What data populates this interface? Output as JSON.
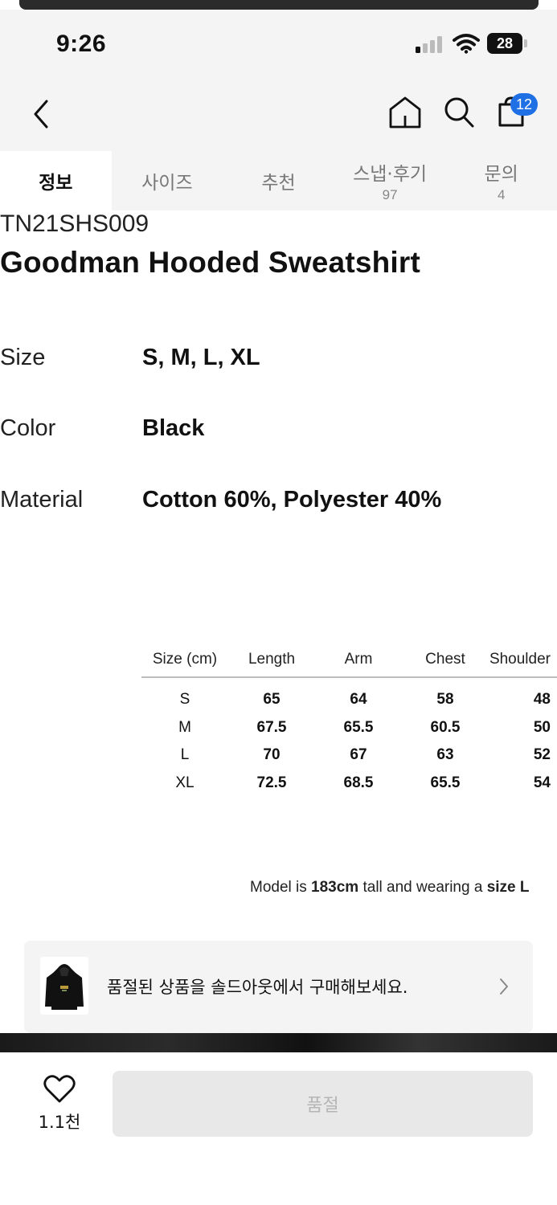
{
  "status_bar": {
    "time": "9:26",
    "battery": "28"
  },
  "header": {
    "cart_count": "12"
  },
  "tabs": [
    {
      "label": "정보",
      "count": ""
    },
    {
      "label": "사이즈",
      "count": ""
    },
    {
      "label": "추천",
      "count": ""
    },
    {
      "label": "스냅·후기",
      "count": "97"
    },
    {
      "label": "문의",
      "count": "4"
    }
  ],
  "product": {
    "code": "TN21SHS009",
    "name": "Goodman Hooded Sweatshirt",
    "specs": [
      {
        "label": "Size",
        "value": "S, M, L, XL"
      },
      {
        "label": "Color",
        "value": "Black"
      },
      {
        "label": "Material",
        "value": "Cotton 60%, Polyester 40%"
      }
    ]
  },
  "size_table": {
    "headers": [
      "Size (cm)",
      "Length",
      "Arm",
      "Chest",
      "Shoulder"
    ],
    "rows": [
      [
        "S",
        "65",
        "64",
        "58",
        "48"
      ],
      [
        "M",
        "67.5",
        "65.5",
        "60.5",
        "50"
      ],
      [
        "L",
        "70",
        "67",
        "63",
        "52"
      ],
      [
        "XL",
        "72.5",
        "68.5",
        "65.5",
        "54"
      ]
    ]
  },
  "model_note": {
    "prefix": "Model is ",
    "height": "183cm",
    "middle": " tall and wearing a ",
    "size": "size L"
  },
  "soldout_banner": {
    "text": "품절된 상품을 솔드아웃에서 구매해보세요."
  },
  "bottom_bar": {
    "like_count": "1.1천",
    "buy_label": "품절"
  }
}
